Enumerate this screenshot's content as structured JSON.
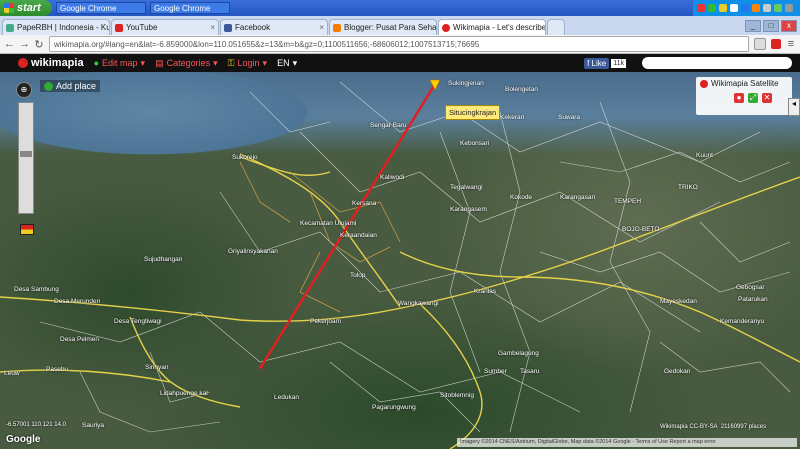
{
  "taskbar": {
    "start": "start",
    "tasks": [
      "Google Chrome",
      "Google Chrome"
    ],
    "tray": {
      "time": ""
    }
  },
  "tabs": [
    {
      "label": "PapeRBH | Indonesia - Kumpu",
      "color": "#4a8"
    },
    {
      "label": "YouTube",
      "color": "#d22"
    },
    {
      "label": "Facebook",
      "color": "#3b5998"
    },
    {
      "label": "Blogger: Pusat Para Sehabat",
      "color": "#f57c00"
    },
    {
      "label": "Wikimapia - Let's describe th",
      "color": "#d22",
      "active": true
    }
  ],
  "address": {
    "url": "wikimapia.org/#lang=en&lat=-6.859000&lon=110.051655&z=13&m=b&gz=0;1100511656;-68606012;1007513715;76695"
  },
  "wikimapia": {
    "logo": "wikimapia",
    "edit_map": "Edit map",
    "categories": "Categories",
    "login": "Login",
    "lang": "EN",
    "fb_like": "Like",
    "fb_count": "11k"
  },
  "map": {
    "add_place": "Add place",
    "sat_title": "Wikimapia Satellite",
    "tooltip": "Situcingkrajan",
    "labels": [
      {
        "text": "Sukingjenan"
      },
      {
        "text": "Sengar Baru"
      },
      {
        "text": "Kekeran"
      },
      {
        "text": "Bolengetan"
      },
      {
        "text": "Suwara"
      },
      {
        "text": "Kebonsari"
      },
      {
        "text": "Sukorejo"
      },
      {
        "text": "Kaliwodi"
      },
      {
        "text": "Kersana"
      },
      {
        "text": "Tegalwangi"
      },
      {
        "text": "Kokode"
      },
      {
        "text": "Karangasem"
      },
      {
        "text": "Karangasari"
      },
      {
        "text": "TEMPEH"
      },
      {
        "text": "BOJO-BETO"
      },
      {
        "text": "TRIKO"
      },
      {
        "text": "Keraandaian"
      },
      {
        "text": "Kecamatan Ulujami"
      },
      {
        "text": "Griyalinsyakanan"
      },
      {
        "text": "Tolop"
      },
      {
        "text": "Sujudhangan"
      },
      {
        "text": "Desa Sambung"
      },
      {
        "text": "Desa Merunden"
      },
      {
        "text": "Wangkawangi"
      },
      {
        "text": "Kranlas"
      },
      {
        "text": "Desa Tengtiwagi"
      },
      {
        "text": "Desa Pelmen"
      },
      {
        "text": "Sirihyan"
      },
      {
        "text": "Pekerjoam"
      },
      {
        "text": "Pasebu"
      },
      {
        "text": "Lidahpuenge kal"
      },
      {
        "text": "Ledukan"
      },
      {
        "text": "Pagarungwung"
      },
      {
        "text": "Sumber"
      },
      {
        "text": "Sitoblemnig"
      },
      {
        "text": "Gambelagung"
      },
      {
        "text": "Tasaru"
      },
      {
        "text": "Gebogsar"
      },
      {
        "text": "Patarukan"
      },
      {
        "text": "Mayeskedan"
      },
      {
        "text": "Kemanderanyu"
      },
      {
        "text": "Gedokan"
      },
      {
        "text": "Sauriya"
      },
      {
        "text": "Kuunt"
      },
      {
        "text": "Leuw"
      }
    ],
    "coords": "-6.57001 110.121 14.0",
    "google": "Google",
    "license": "Wikimapia CC-BY-SA",
    "places": "21160997 places",
    "copyright": "Imagery ©2014 CNES/Astrium, DigitalGlobe, Map data ©2014 Google - Terms of Use  Report a map error"
  }
}
